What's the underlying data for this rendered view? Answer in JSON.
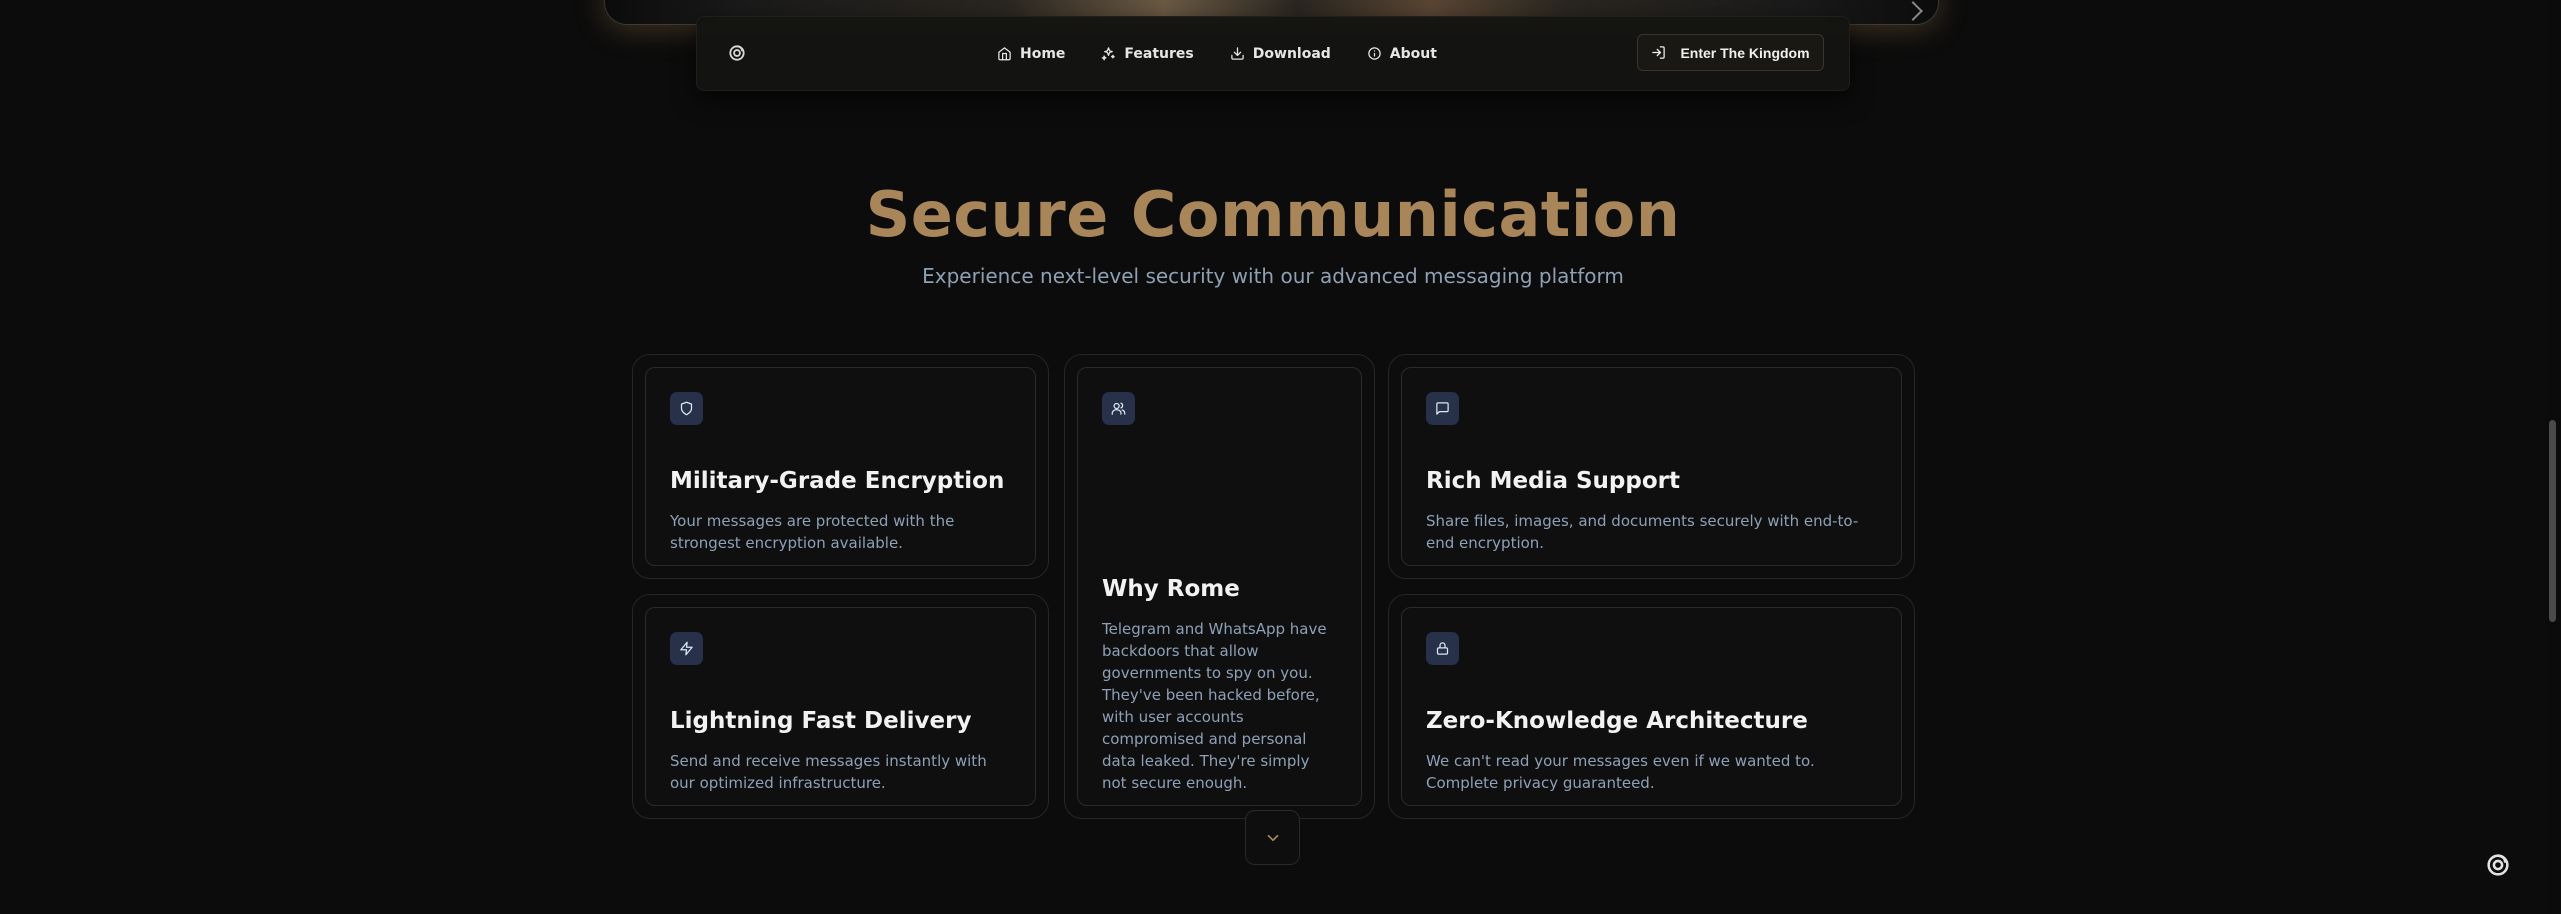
{
  "nav": {
    "links": [
      {
        "label": "Home",
        "icon": "home-icon"
      },
      {
        "label": "Features",
        "icon": "sparkles-icon"
      },
      {
        "label": "Download",
        "icon": "download-icon"
      },
      {
        "label": "About",
        "icon": "info-icon"
      }
    ],
    "cta_label": "Enter The Kingdom",
    "cta_icon": "log-in-icon"
  },
  "section": {
    "title": "Secure Communication",
    "subtitle": "Experience next-level security with our advanced messaging platform"
  },
  "cards": [
    {
      "title": "Military-Grade Encryption",
      "description": "Your messages are protected with the strongest encryption available.",
      "icon": "shield-icon"
    },
    {
      "title": "Why Rome",
      "description": "Telegram and WhatsApp have backdoors that allow governments to spy on you. They've been hacked before, with user accounts compromised and personal data leaked. They're simply not secure enough.",
      "icon": "users-icon"
    },
    {
      "title": "Rich Media Support",
      "description": "Share files, images, and documents securely with end-to-end encryption.",
      "icon": "message-square-icon"
    },
    {
      "title": "Lightning Fast Delivery",
      "description": "Send and receive messages instantly with our optimized infrastructure.",
      "icon": "zap-icon"
    },
    {
      "title": "Zero-Knowledge Architecture",
      "description": "We can't read your messages even if we wanted to. Complete privacy guaranteed.",
      "icon": "lock-icon"
    }
  ],
  "colors": {
    "accent": "#a8865a",
    "background": "#0c0c0c",
    "icon_bg": "#27314a",
    "muted_text": "#8ea0b6"
  }
}
